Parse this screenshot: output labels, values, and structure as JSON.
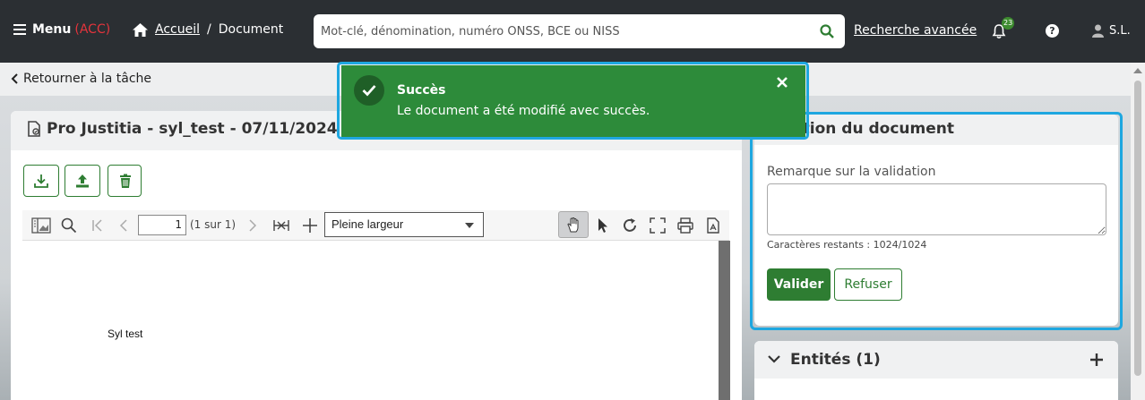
{
  "topbar": {
    "menu_label": "Menu",
    "menu_env": "(ACC)",
    "breadcrumb": {
      "home": "Accueil",
      "separator": "/",
      "current": "Document"
    },
    "search": {
      "placeholder": "Mot-clé, dénomination, numéro ONSS, BCE ou NISS",
      "value": ""
    },
    "advanced_search": "Recherche avancée",
    "notifications_count": "23",
    "help_label": "?",
    "user_initials": "S.L."
  },
  "back_link": "Retourner à la tâche",
  "document": {
    "title": "Pro Justitia - syl_test - 07/11/2024 - En co",
    "pdf": {
      "page_number": "1",
      "page_of": "(1 sur 1)",
      "zoom": "Pleine largeur",
      "content_text": "Syl test"
    }
  },
  "toast": {
    "title": "Succès",
    "message": "Le document a été modifié avec succès."
  },
  "validation": {
    "title": "dation du document",
    "remark_label": "Remarque sur la validation",
    "remark_value": "",
    "remaining": "Caractères restants : 1024/1024",
    "validate_label": "Valider",
    "refuse_label": "Refuser"
  },
  "entities": {
    "title": "Entités (1)"
  },
  "colors": {
    "navbar": "#2b2f33",
    "accent_green": "#2e7d32",
    "toast_green": "#2d8b3a",
    "highlight_blue": "#1ea7e0",
    "env_red": "#e4343c"
  }
}
